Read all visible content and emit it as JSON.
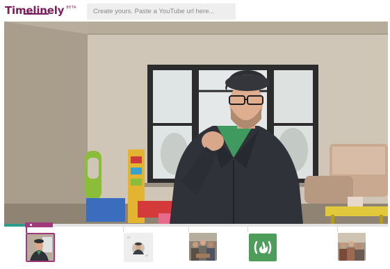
{
  "app": {
    "logo_text": "Timelinely",
    "beta_label": "BETA"
  },
  "search": {
    "placeholder": "Create yours. Paste a YouTube url here..."
  },
  "video": {
    "progress": 0.0616
  },
  "timeline": {
    "markers": [
      {
        "icon": "person-thumbnail",
        "active": true
      },
      {
        "icon": "quote-person-thumbnail",
        "active": false
      },
      {
        "icon": "group-photo-thumbnail",
        "active": false
      },
      {
        "icon": "freecodecamp-fire-icon",
        "active": false
      },
      {
        "icon": "crowd-photo-thumbnail",
        "active": false
      }
    ]
  },
  "colors": {
    "brand": "#7a1f5c",
    "scrubber": "#a03a7d",
    "progress": "#2e9c8a",
    "fcc_green": "#4f9d5b"
  }
}
